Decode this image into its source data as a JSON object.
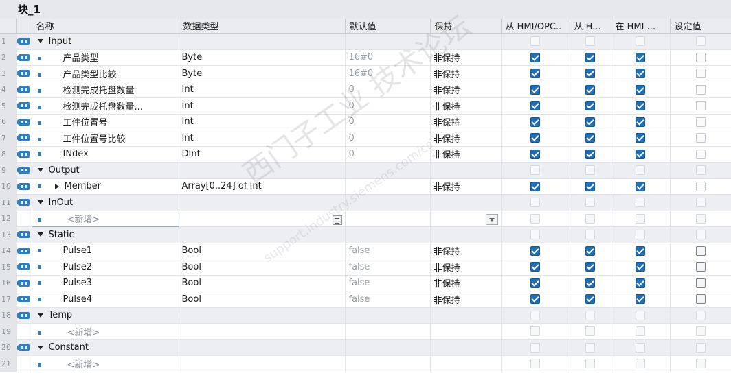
{
  "block_title": "块_1",
  "columns": [
    "名称",
    "数据类型",
    "默认值",
    "保持",
    "从 HMI/OPC..",
    "从 H...",
    "在 HMI ...",
    "设定值"
  ],
  "rows": [
    {
      "num": "1",
      "kind": "section",
      "name": "Input",
      "type": "",
      "default": "",
      "retain": "",
      "c1": false,
      "c2": false,
      "c3": false,
      "c4": false
    },
    {
      "num": "2",
      "kind": "member",
      "name": "产品类型",
      "type": "Byte",
      "default": "16#0",
      "retain": "非保持",
      "c1": true,
      "c2": true,
      "c3": true,
      "c4": false
    },
    {
      "num": "3",
      "kind": "member",
      "name": "产品类型比较",
      "type": "Byte",
      "default": "16#0",
      "retain": "非保持",
      "c1": true,
      "c2": true,
      "c3": true,
      "c4": false
    },
    {
      "num": "4",
      "kind": "member",
      "name": "检测完成托盘数量",
      "type": "Int",
      "default": "0",
      "retain": "非保持",
      "c1": true,
      "c2": true,
      "c3": true,
      "c4": false
    },
    {
      "num": "5",
      "kind": "member",
      "name": "检测完成托盘数量...",
      "type": "Int",
      "default": "0",
      "retain": "非保持",
      "c1": true,
      "c2": true,
      "c3": true,
      "c4": false
    },
    {
      "num": "6",
      "kind": "member",
      "name": "工件位置号",
      "type": "Int",
      "default": "0",
      "retain": "非保持",
      "c1": true,
      "c2": true,
      "c3": true,
      "c4": false
    },
    {
      "num": "7",
      "kind": "member",
      "name": "工件位置号比较",
      "type": "Int",
      "default": "0",
      "retain": "非保持",
      "c1": true,
      "c2": true,
      "c3": true,
      "c4": false
    },
    {
      "num": "8",
      "kind": "member",
      "name": "INdex",
      "type": "DInt",
      "default": "0",
      "retain": "非保持",
      "c1": true,
      "c2": true,
      "c3": true,
      "c4": false
    },
    {
      "num": "9",
      "kind": "section",
      "name": "Output",
      "type": "",
      "default": "",
      "retain": "",
      "c1": false,
      "c2": false,
      "c3": false,
      "c4": false
    },
    {
      "num": "10",
      "kind": "array",
      "name": "Member",
      "type": "Array[0..24] of Int",
      "default": "",
      "retain": "非保持",
      "c1": true,
      "c2": true,
      "c3": true,
      "c4": false
    },
    {
      "num": "11",
      "kind": "section",
      "name": "InOut",
      "type": "",
      "default": "",
      "retain": "",
      "c1": false,
      "c2": false,
      "c3": false,
      "c4": false
    },
    {
      "num": "12",
      "kind": "new-edit",
      "name": "<新增>",
      "type": "",
      "default": "",
      "retain": "",
      "c1": false,
      "c2": false,
      "c3": false,
      "c4": false
    },
    {
      "num": "13",
      "kind": "section",
      "name": "Static",
      "type": "",
      "default": "",
      "retain": "",
      "c1": false,
      "c2": false,
      "c3": false,
      "c4": false
    },
    {
      "num": "14",
      "kind": "member",
      "name": "Pulse1",
      "type": "Bool",
      "default": "false",
      "retain": "非保持",
      "c1": true,
      "c2": true,
      "c3": true,
      "c4": "dark"
    },
    {
      "num": "15",
      "kind": "member",
      "name": "Pulse2",
      "type": "Bool",
      "default": "false",
      "retain": "非保持",
      "c1": true,
      "c2": true,
      "c3": true,
      "c4": "dark"
    },
    {
      "num": "16",
      "kind": "member",
      "name": "Pulse3",
      "type": "Bool",
      "default": "false",
      "retain": "非保持",
      "c1": true,
      "c2": true,
      "c3": true,
      "c4": "dark"
    },
    {
      "num": "17",
      "kind": "member",
      "name": "Pulse4",
      "type": "Bool",
      "default": "false",
      "retain": "非保持",
      "c1": true,
      "c2": true,
      "c3": true,
      "c4": "dark"
    },
    {
      "num": "18",
      "kind": "section",
      "name": "Temp",
      "type": "",
      "default": "",
      "retain": "",
      "c1": false,
      "c2": false,
      "c3": false,
      "c4": false
    },
    {
      "num": "19",
      "kind": "new",
      "name": "<新增>",
      "type": "",
      "default": "",
      "retain": "",
      "c1": false,
      "c2": false,
      "c3": false,
      "c4": false
    },
    {
      "num": "20",
      "kind": "section",
      "name": "Constant",
      "type": "",
      "default": "",
      "retain": "",
      "c1": false,
      "c2": false,
      "c3": false,
      "c4": false
    },
    {
      "num": "21",
      "kind": "new",
      "name": "<新增>",
      "type": "",
      "default": "",
      "retain": "",
      "c1": false,
      "c2": false,
      "c3": false,
      "c4": false
    }
  ],
  "watermark": {
    "main": "西门子工业 技术论坛",
    "sub": "support.industry.siemens.com/cs"
  },
  "colors": {
    "checked": "#1e6fb8",
    "section_bg": "#eceef1",
    "header_bg": "#e9ebee",
    "icon_blue": "#2e7fc2"
  },
  "icons": {
    "interface": "interface-icon",
    "expanded": "expand-triangle-icon",
    "collapsed": "collapsed-triangle-icon",
    "member": "member-bullet-icon"
  }
}
